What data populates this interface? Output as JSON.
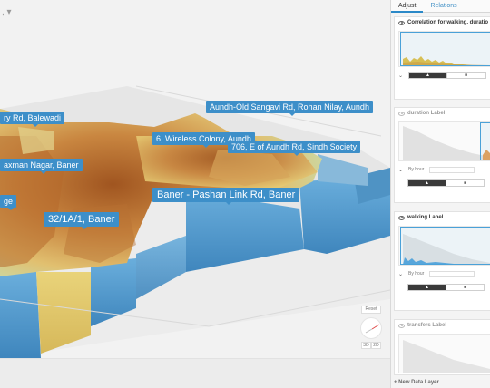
{
  "map": {
    "top_left_control": ", ▾",
    "labels": [
      {
        "id": "balewadi",
        "text": "ry Rd, Balewadi",
        "size": "small"
      },
      {
        "id": "aundh-old",
        "text": "Aundh-Old Sangavi Rd, Rohan Nilay, Aundh",
        "size": "small"
      },
      {
        "id": "wireless",
        "text": "6, Wireless Colony, Aundh",
        "size": "small"
      },
      {
        "id": "sindh",
        "text": "706, E of Aundh Rd, Sindh Society",
        "size": "small"
      },
      {
        "id": "laxman",
        "text": "axman Nagar, Baner",
        "size": "small"
      },
      {
        "id": "pashan",
        "text": "Baner - Pashan Link Rd, Baner",
        "size": "big"
      },
      {
        "id": "ge",
        "text": "ge",
        "size": "small"
      },
      {
        "id": "baner321",
        "text": "32/1A/1, Baner",
        "size": "big"
      }
    ],
    "reset_label": "Reset",
    "zoom_in": "3D",
    "zoom_out": "2D",
    "colors": {
      "heat_high": "#a6581c",
      "heat_mid": "#d79a4e",
      "heat_low": "#e7cf72",
      "extrude_blue": "#5a9fcf",
      "label_bg": "#3d8fc9"
    }
  },
  "panel": {
    "tabs": [
      {
        "label": "Adjust",
        "active": true
      },
      {
        "label": "Relations",
        "active": false
      }
    ],
    "cards": [
      {
        "title": "Correlation for walking, duratio",
        "visible": true,
        "has_by": false,
        "seg_left": "▲",
        "seg_right": "■"
      },
      {
        "title": "duration Label",
        "visible": false,
        "has_by": true,
        "by_label": "By hour",
        "seg_left": "▲",
        "seg_right": "■"
      },
      {
        "title": "walking Label",
        "visible": true,
        "has_by": true,
        "by_label": "By hour",
        "seg_left": "▲",
        "seg_right": "■"
      },
      {
        "title": "transfers Label",
        "visible": false,
        "has_by": false
      }
    ],
    "new_layers": "+ New Data Layer"
  }
}
